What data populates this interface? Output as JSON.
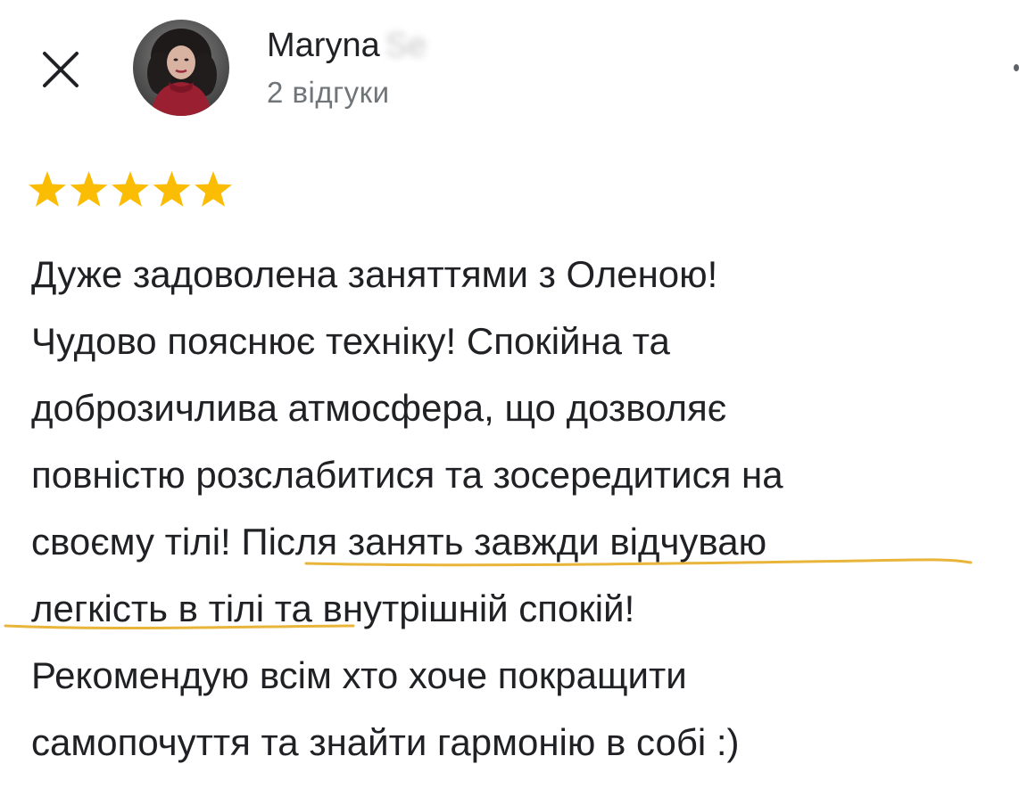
{
  "header": {
    "close_icon": "close-icon",
    "avatar_icon": "reviewer-avatar",
    "reviewer_name": "Maryna",
    "reviewer_surname_partial": "Se",
    "review_count": "2 відгуки",
    "more_icon": "more-options-icon"
  },
  "review": {
    "rating": 5,
    "rating_max": 5,
    "star_color": "#fbbc04",
    "highlight_color": "#e8b53a",
    "lines": [
      "Дуже задоволена заняттями з Оленою!",
      "Чудово пояснює техніку! Спокійна та",
      "доброзичлива атмосфера, що дозволяє",
      "повністю розслабитися та зосередитися на",
      "своєму тілі! Після занять завжди відчуваю",
      "легкість в тілі та внутрішній спокій!",
      "Рекомендую всім хто хоче покращити",
      "самопочуття та знайти гармонію в собі :)"
    ]
  }
}
